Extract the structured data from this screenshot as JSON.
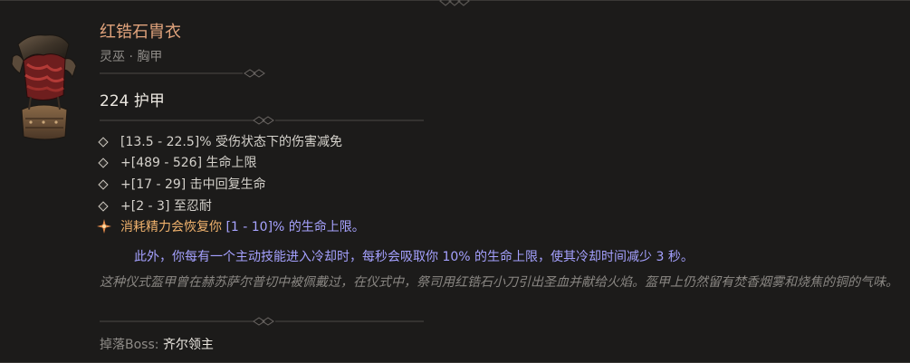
{
  "item": {
    "name": "红锆石胄衣",
    "type_line": "灵巫 · 胸甲",
    "armor": "224 护甲",
    "icon": "chest-armor-icon"
  },
  "affixes": [
    {
      "text": "[13.5 - 22.5]% 受伤状态下的伤害减免"
    },
    {
      "text": "+[489 - 526] 生命上限"
    },
    {
      "text": "+[17 - 29] 击中回复生命"
    },
    {
      "text": "+[2 - 3] 至忍耐"
    }
  ],
  "legendary": {
    "text": "消耗精力会恢复你",
    "range": "[1 - 10]% 的生命上限。",
    "extra": "此外，你每有一个主动技能进入冷却时，每秒会吸取你 10% 的生命上限，使其冷却时间减少 3 秒。"
  },
  "flavor": "这种仪式盔甲曾在赫苏萨尔普切中被佩戴过，在仪式中，祭司用红锆石小刀引出圣血并献给火焰。盔甲上仍然留有焚香烟雾和烧焦的铜的气味。",
  "drop": {
    "label": "掉落Boss:",
    "value": "齐尔领主"
  },
  "colors": {
    "name": "#e1a37c",
    "legendary": "#f0b26d",
    "legendary_range": "#a7a3ff",
    "background": "#1c1b1a"
  }
}
